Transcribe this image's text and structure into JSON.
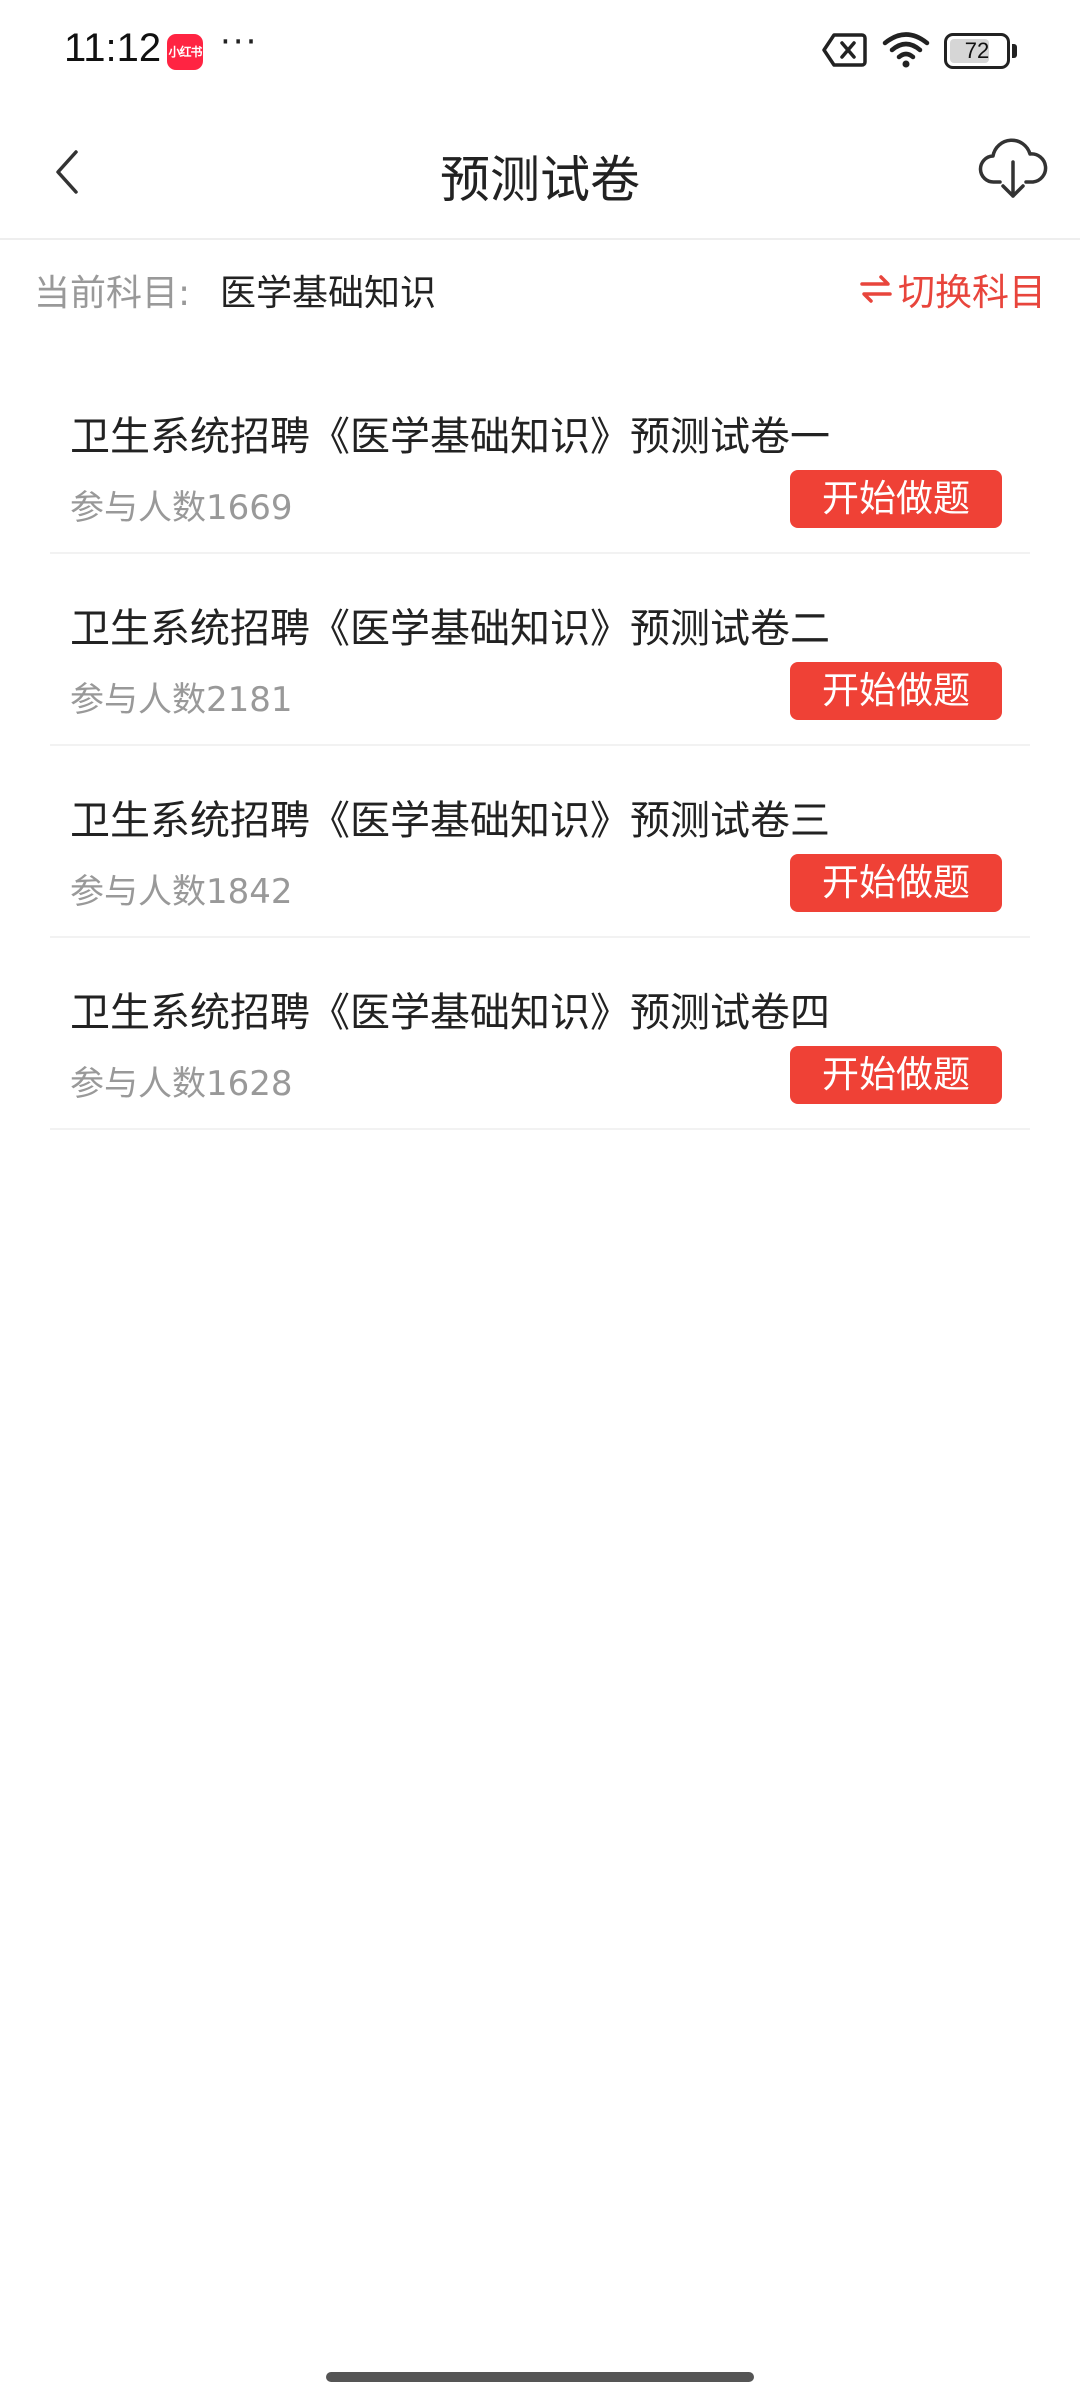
{
  "status_bar": {
    "time": "11:12",
    "app_badge": "小红书",
    "more_dots": "···",
    "battery_level": "72",
    "battery_fraction": 0.72
  },
  "header": {
    "title": "预测试卷"
  },
  "subject_bar": {
    "label": "当前科目:",
    "value": "医学基础知识",
    "switch_label": "切换科目"
  },
  "papers": [
    {
      "title": "卫生系统招聘《医学基础知识》预测试卷一",
      "count": "参与人数1669",
      "button": "开始做题"
    },
    {
      "title": "卫生系统招聘《医学基础知识》预测试卷二",
      "count": "参与人数2181",
      "button": "开始做题"
    },
    {
      "title": "卫生系统招聘《医学基础知识》预测试卷三",
      "count": "参与人数1842",
      "button": "开始做题"
    },
    {
      "title": "卫生系统招聘《医学基础知识》预测试卷四",
      "count": "参与人数1628",
      "button": "开始做题"
    }
  ],
  "colors": {
    "accent": "#ef4136",
    "muted_text": "#999999"
  }
}
